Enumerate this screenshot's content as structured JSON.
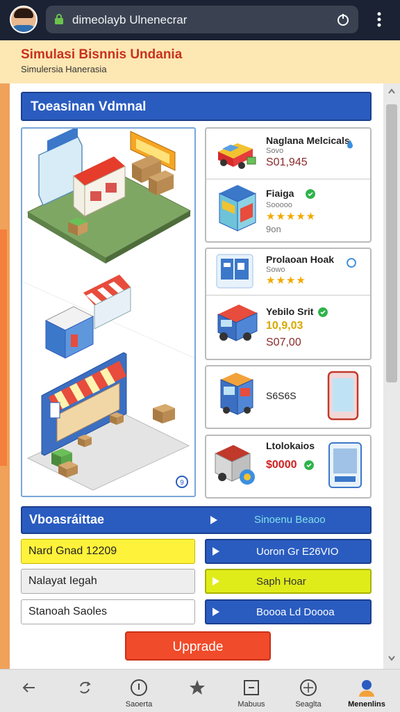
{
  "browser": {
    "url": "dimeolayb Ulnenecrar",
    "icons": [
      "avatar",
      "lock-icon",
      "refresh-icon",
      "menu-icon"
    ]
  },
  "header": {
    "title": "Simulasi Bisnnis Undania",
    "subtitle": "Simulersia Hanerasia"
  },
  "section": {
    "title": "Toeasinan Vdmnal"
  },
  "items": [
    {
      "name": "Naglana Melcicals",
      "small": "Sovo",
      "price": "S01,945"
    },
    {
      "name": "Fiaiga",
      "small": "Sooooo",
      "stars": "★★★★★",
      "extra": "9on"
    },
    {
      "name": "Prolaoan Hoak",
      "small": "Sowo",
      "stars": "★★★★"
    },
    {
      "name": "Yebilo Srit",
      "price_top": "10,9,03",
      "price": "S07,00"
    },
    {
      "name": "S6S6S"
    },
    {
      "name": "Ltolokaios",
      "price": "$0000"
    }
  ],
  "stats": {
    "title": "Vboasráittae",
    "right_label": "Sinoenu Beaoo",
    "boxes": [
      "Nard Gnad 12209",
      "Nalayat Iegah",
      "Stanoah Saoles"
    ],
    "buttons": [
      "Uoron Gr E26VIO",
      "Saph Hoar",
      "Boooa Ld Doooa"
    ]
  },
  "upgrade_label": "Upprade",
  "nav": {
    "items": [
      {
        "icon": "back-arrow-icon",
        "label": ""
      },
      {
        "icon": "repeat-icon",
        "label": ""
      },
      {
        "icon": "info-circle-icon",
        "label": "Saoerta"
      },
      {
        "icon": "star-icon",
        "label": ""
      },
      {
        "icon": "minus-square-icon",
        "label": "Mabuus"
      },
      {
        "icon": "compass-icon",
        "label": "Seaglta"
      },
      {
        "icon": "profile-icon",
        "label": "Menenlins"
      }
    ]
  },
  "colors": {
    "topbar": "#1a2233",
    "header": "#fde7b3",
    "accent_blue": "#2a5cc0",
    "title_red": "#c8321e",
    "upgrade": "#f04b2a",
    "highlight_yellow": "#fff23a"
  }
}
